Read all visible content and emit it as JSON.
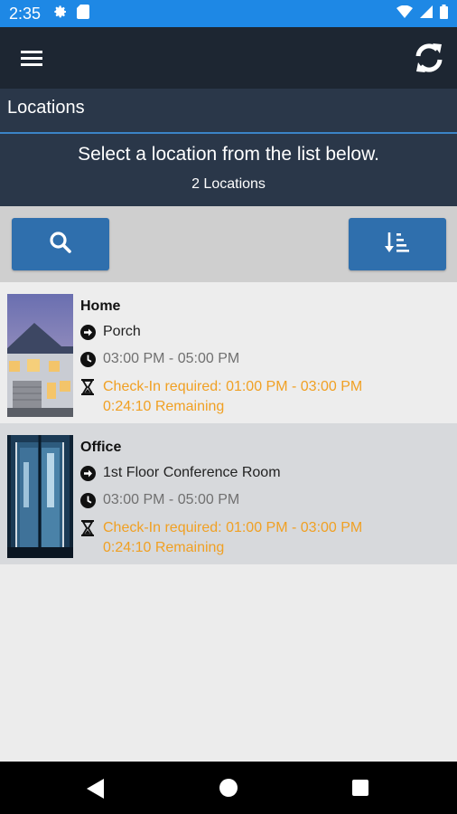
{
  "status_bar": {
    "time": "2:35",
    "left_icons": [
      "gear-icon",
      "sd-card-icon"
    ],
    "right_icons": [
      "wifi-icon",
      "signal-icon",
      "battery-icon"
    ]
  },
  "app_bar": {
    "menu_icon": "hamburger-menu-icon",
    "refresh_icon": "refresh-icon"
  },
  "title_bar": {
    "title": "Locations"
  },
  "info": {
    "instruction": "Select a location from the list below.",
    "count": "2 Locations"
  },
  "toolbar": {
    "search_icon": "search-icon",
    "sort_icon": "sort-icon"
  },
  "locations": [
    {
      "name": "Home",
      "place": "Porch",
      "time": "03:00 PM - 05:00 PM",
      "checkin": "Check-In required: 01:00 PM - 03:00 PM",
      "remaining": "0:24:10 Remaining",
      "thumbnail": "house-photo"
    },
    {
      "name": "Office",
      "place": "1st Floor Conference Room",
      "time": "03:00 PM - 05:00 PM",
      "checkin": "Check-In required: 01:00 PM - 03:00 PM",
      "remaining": "0:24:10 Remaining",
      "thumbnail": "office-door-photo"
    }
  ],
  "colors": {
    "status_bar": "#1e88e5",
    "app_bar": "#1d2632",
    "header_panel": "#2a3749",
    "button": "#2f6fad",
    "checkin_text": "#f0a023"
  }
}
